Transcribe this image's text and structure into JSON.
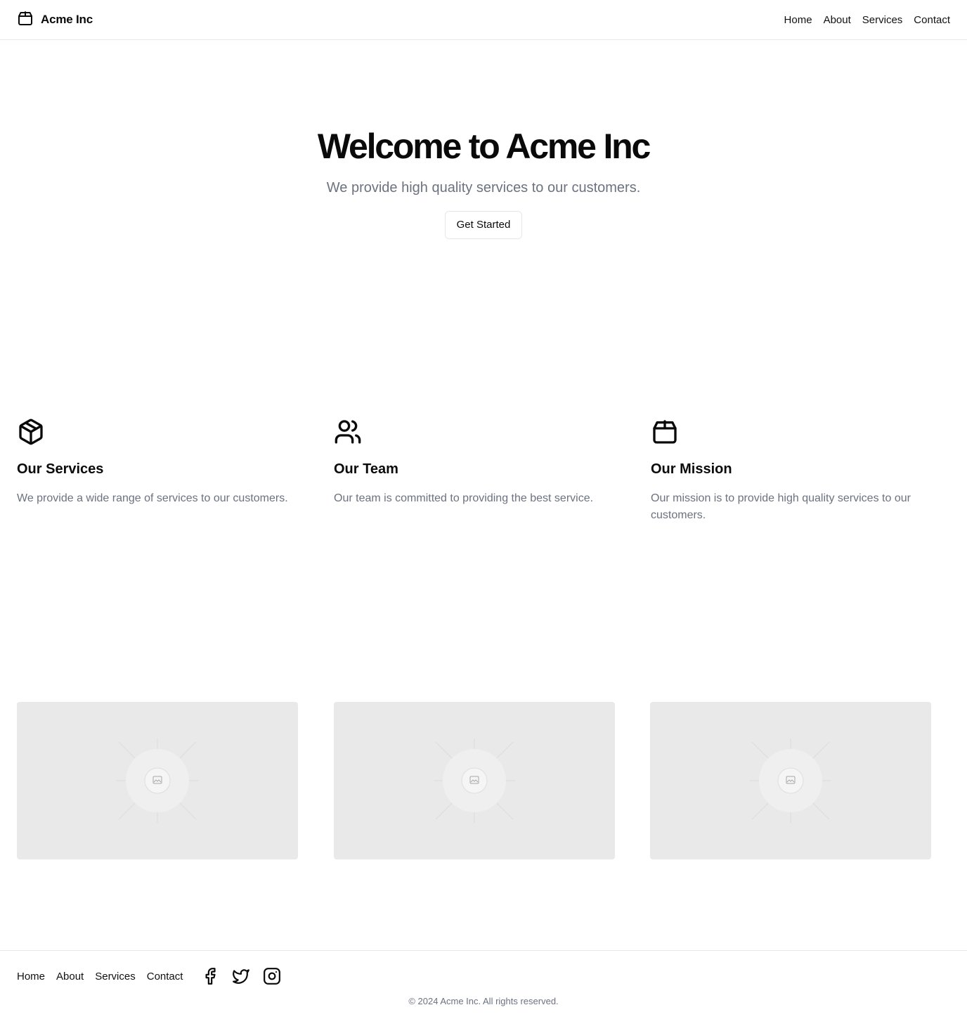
{
  "header": {
    "brand": "Acme Inc",
    "brand_icon": "package-icon",
    "nav": [
      "Home",
      "About",
      "Services",
      "Contact"
    ]
  },
  "hero": {
    "title": "Welcome to Acme Inc",
    "subtitle": "We provide high quality services to our customers.",
    "cta_label": "Get Started"
  },
  "features": [
    {
      "icon": "box-icon",
      "title": "Our Services",
      "description": "We provide a wide range of services to our customers."
    },
    {
      "icon": "users-icon",
      "title": "Our Team",
      "description": "Our team is committed to providing the best service."
    },
    {
      "icon": "package-icon",
      "title": "Our Mission",
      "description": "Our mission is to provide high quality services to our customers."
    }
  ],
  "gallery": [
    {
      "icon": "image-placeholder-icon"
    },
    {
      "icon": "image-placeholder-icon"
    },
    {
      "icon": "image-placeholder-icon"
    }
  ],
  "footer": {
    "nav": [
      "Home",
      "About",
      "Services",
      "Contact"
    ],
    "social": [
      "facebook-icon",
      "twitter-icon",
      "instagram-icon"
    ],
    "copyright": "© 2024 Acme Inc. All rights reserved."
  },
  "colors": {
    "text": "#0a0a0a",
    "muted": "#6b7280",
    "border": "#e5e7eb",
    "placeholder_bg": "#e9e9e9"
  }
}
